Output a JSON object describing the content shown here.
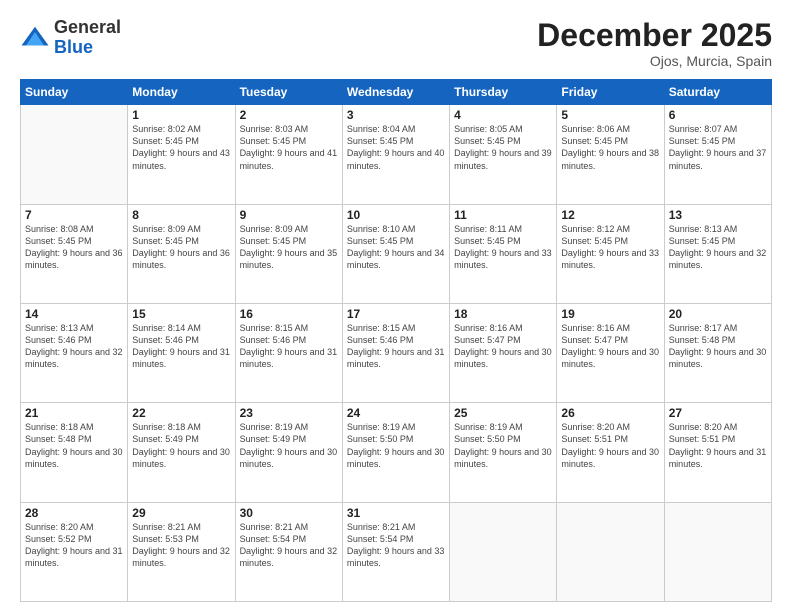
{
  "header": {
    "logo_general": "General",
    "logo_blue": "Blue",
    "month_title": "December 2025",
    "location": "Ojos, Murcia, Spain"
  },
  "days_of_week": [
    "Sunday",
    "Monday",
    "Tuesday",
    "Wednesday",
    "Thursday",
    "Friday",
    "Saturday"
  ],
  "weeks": [
    [
      {
        "day": "",
        "sunrise": "",
        "sunset": "",
        "daylight": ""
      },
      {
        "day": "1",
        "sunrise": "Sunrise: 8:02 AM",
        "sunset": "Sunset: 5:45 PM",
        "daylight": "Daylight: 9 hours and 43 minutes."
      },
      {
        "day": "2",
        "sunrise": "Sunrise: 8:03 AM",
        "sunset": "Sunset: 5:45 PM",
        "daylight": "Daylight: 9 hours and 41 minutes."
      },
      {
        "day": "3",
        "sunrise": "Sunrise: 8:04 AM",
        "sunset": "Sunset: 5:45 PM",
        "daylight": "Daylight: 9 hours and 40 minutes."
      },
      {
        "day": "4",
        "sunrise": "Sunrise: 8:05 AM",
        "sunset": "Sunset: 5:45 PM",
        "daylight": "Daylight: 9 hours and 39 minutes."
      },
      {
        "day": "5",
        "sunrise": "Sunrise: 8:06 AM",
        "sunset": "Sunset: 5:45 PM",
        "daylight": "Daylight: 9 hours and 38 minutes."
      },
      {
        "day": "6",
        "sunrise": "Sunrise: 8:07 AM",
        "sunset": "Sunset: 5:45 PM",
        "daylight": "Daylight: 9 hours and 37 minutes."
      }
    ],
    [
      {
        "day": "7",
        "sunrise": "Sunrise: 8:08 AM",
        "sunset": "Sunset: 5:45 PM",
        "daylight": "Daylight: 9 hours and 36 minutes."
      },
      {
        "day": "8",
        "sunrise": "Sunrise: 8:09 AM",
        "sunset": "Sunset: 5:45 PM",
        "daylight": "Daylight: 9 hours and 36 minutes."
      },
      {
        "day": "9",
        "sunrise": "Sunrise: 8:09 AM",
        "sunset": "Sunset: 5:45 PM",
        "daylight": "Daylight: 9 hours and 35 minutes."
      },
      {
        "day": "10",
        "sunrise": "Sunrise: 8:10 AM",
        "sunset": "Sunset: 5:45 PM",
        "daylight": "Daylight: 9 hours and 34 minutes."
      },
      {
        "day": "11",
        "sunrise": "Sunrise: 8:11 AM",
        "sunset": "Sunset: 5:45 PM",
        "daylight": "Daylight: 9 hours and 33 minutes."
      },
      {
        "day": "12",
        "sunrise": "Sunrise: 8:12 AM",
        "sunset": "Sunset: 5:45 PM",
        "daylight": "Daylight: 9 hours and 33 minutes."
      },
      {
        "day": "13",
        "sunrise": "Sunrise: 8:13 AM",
        "sunset": "Sunset: 5:45 PM",
        "daylight": "Daylight: 9 hours and 32 minutes."
      }
    ],
    [
      {
        "day": "14",
        "sunrise": "Sunrise: 8:13 AM",
        "sunset": "Sunset: 5:46 PM",
        "daylight": "Daylight: 9 hours and 32 minutes."
      },
      {
        "day": "15",
        "sunrise": "Sunrise: 8:14 AM",
        "sunset": "Sunset: 5:46 PM",
        "daylight": "Daylight: 9 hours and 31 minutes."
      },
      {
        "day": "16",
        "sunrise": "Sunrise: 8:15 AM",
        "sunset": "Sunset: 5:46 PM",
        "daylight": "Daylight: 9 hours and 31 minutes."
      },
      {
        "day": "17",
        "sunrise": "Sunrise: 8:15 AM",
        "sunset": "Sunset: 5:46 PM",
        "daylight": "Daylight: 9 hours and 31 minutes."
      },
      {
        "day": "18",
        "sunrise": "Sunrise: 8:16 AM",
        "sunset": "Sunset: 5:47 PM",
        "daylight": "Daylight: 9 hours and 30 minutes."
      },
      {
        "day": "19",
        "sunrise": "Sunrise: 8:16 AM",
        "sunset": "Sunset: 5:47 PM",
        "daylight": "Daylight: 9 hours and 30 minutes."
      },
      {
        "day": "20",
        "sunrise": "Sunrise: 8:17 AM",
        "sunset": "Sunset: 5:48 PM",
        "daylight": "Daylight: 9 hours and 30 minutes."
      }
    ],
    [
      {
        "day": "21",
        "sunrise": "Sunrise: 8:18 AM",
        "sunset": "Sunset: 5:48 PM",
        "daylight": "Daylight: 9 hours and 30 minutes."
      },
      {
        "day": "22",
        "sunrise": "Sunrise: 8:18 AM",
        "sunset": "Sunset: 5:49 PM",
        "daylight": "Daylight: 9 hours and 30 minutes."
      },
      {
        "day": "23",
        "sunrise": "Sunrise: 8:19 AM",
        "sunset": "Sunset: 5:49 PM",
        "daylight": "Daylight: 9 hours and 30 minutes."
      },
      {
        "day": "24",
        "sunrise": "Sunrise: 8:19 AM",
        "sunset": "Sunset: 5:50 PM",
        "daylight": "Daylight: 9 hours and 30 minutes."
      },
      {
        "day": "25",
        "sunrise": "Sunrise: 8:19 AM",
        "sunset": "Sunset: 5:50 PM",
        "daylight": "Daylight: 9 hours and 30 minutes."
      },
      {
        "day": "26",
        "sunrise": "Sunrise: 8:20 AM",
        "sunset": "Sunset: 5:51 PM",
        "daylight": "Daylight: 9 hours and 30 minutes."
      },
      {
        "day": "27",
        "sunrise": "Sunrise: 8:20 AM",
        "sunset": "Sunset: 5:51 PM",
        "daylight": "Daylight: 9 hours and 31 minutes."
      }
    ],
    [
      {
        "day": "28",
        "sunrise": "Sunrise: 8:20 AM",
        "sunset": "Sunset: 5:52 PM",
        "daylight": "Daylight: 9 hours and 31 minutes."
      },
      {
        "day": "29",
        "sunrise": "Sunrise: 8:21 AM",
        "sunset": "Sunset: 5:53 PM",
        "daylight": "Daylight: 9 hours and 32 minutes."
      },
      {
        "day": "30",
        "sunrise": "Sunrise: 8:21 AM",
        "sunset": "Sunset: 5:54 PM",
        "daylight": "Daylight: 9 hours and 32 minutes."
      },
      {
        "day": "31",
        "sunrise": "Sunrise: 8:21 AM",
        "sunset": "Sunset: 5:54 PM",
        "daylight": "Daylight: 9 hours and 33 minutes."
      },
      {
        "day": "",
        "sunrise": "",
        "sunset": "",
        "daylight": ""
      },
      {
        "day": "",
        "sunrise": "",
        "sunset": "",
        "daylight": ""
      },
      {
        "day": "",
        "sunrise": "",
        "sunset": "",
        "daylight": ""
      }
    ]
  ]
}
